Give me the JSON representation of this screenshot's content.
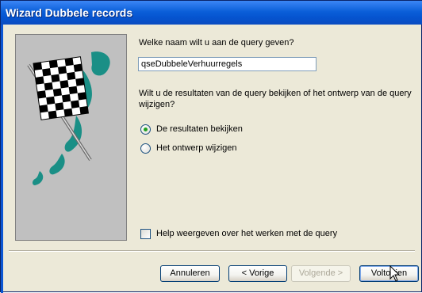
{
  "window": {
    "title": "Wizard Dubbele records"
  },
  "question": "Welke naam wilt u aan de query geven?",
  "query_name": {
    "value": "qseDubbeleVerhuurregels"
  },
  "question2_line1": "Wilt u de resultaten van de query bekijken of het ontwerp van de query",
  "question2_line2": "wijzigen?",
  "options": [
    {
      "label": "De resultaten bekijken",
      "selected": true
    },
    {
      "label": "Het ontwerp wijzigen",
      "selected": false
    }
  ],
  "help_checkbox": {
    "label": "Help weergeven over het werken met de query",
    "checked": false
  },
  "buttons": {
    "cancel": "Annuleren",
    "back": "< Vorige",
    "next": "Volgende >",
    "finish": "Voltooien"
  },
  "colors": {
    "titlebar": "#0554d0",
    "dialog": "#ece9d8",
    "flag_green": "#1a8f86"
  }
}
